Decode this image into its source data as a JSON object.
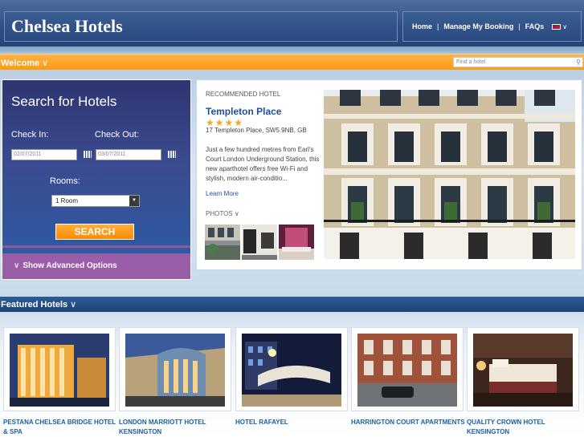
{
  "header": {
    "logo": "Chelsea Hotels",
    "nav": [
      {
        "label": "Home"
      },
      {
        "label": "Manage My Booking"
      },
      {
        "label": "FAQs"
      }
    ],
    "language_flag": "uk-flag-icon"
  },
  "welcome": {
    "label": "Welcome",
    "search_placeholder": "Find a hotel"
  },
  "search": {
    "title": "Search for Hotels",
    "checkin_label": "Check In:",
    "checkin_value": "02/07/2011",
    "checkout_label": "Check Out:",
    "checkout_value": "03/07/2011",
    "rooms_label": "Rooms:",
    "rooms_value": "1 Room",
    "button": "SEARCH",
    "advanced": "Show Advanced Options"
  },
  "recommended": {
    "heading": "RECOMMENDED HOTEL",
    "name": "Templeton Place",
    "stars": "★★★★",
    "star_count": 4,
    "address": "17 Templeton Place, SW5 9NB, GB",
    "description": "Just a few hundred metres from Earl's Court London Underground Station, this new aparthotel offers free Wi-Fi and stylish, modern air-conditio...",
    "more": "Learn More",
    "photos_label": "PHOTOS"
  },
  "featured": {
    "label": "Featured Hotels",
    "hotels": [
      {
        "name": "PESTANA CHELSEA BRIDGE HOTEL & SPA"
      },
      {
        "name": "LONDON MARRIOTT HOTEL KENSINGTON"
      },
      {
        "name": "HOTEL RAFAYEL"
      },
      {
        "name": "HARRINGTON COURT APARTMENTS"
      },
      {
        "name": "QUALITY CROWN HOTEL KENSINGTON"
      }
    ]
  },
  "colors": {
    "accent_orange": "#ff9a0e",
    "brand_navy": "#2f4f85",
    "link_blue": "#1f4e9c",
    "advanced_purple": "#9a5ea8"
  }
}
